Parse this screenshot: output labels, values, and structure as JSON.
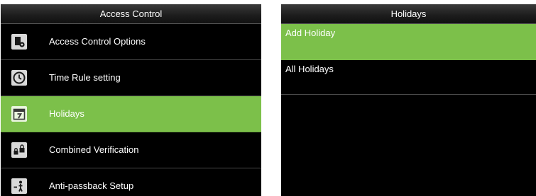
{
  "left_screen": {
    "title": "Access Control",
    "items": [
      {
        "label": "Access Control Options",
        "icon": "access-options-icon",
        "selected": false
      },
      {
        "label": "Time Rule setting",
        "icon": "clock-icon",
        "selected": false
      },
      {
        "label": "Holidays",
        "icon": "calendar-icon",
        "selected": true
      },
      {
        "label": "Combined Verification",
        "icon": "locks-icon",
        "selected": false
      },
      {
        "label": "Anti-passback Setup",
        "icon": "anti-passback-icon",
        "selected": false
      }
    ]
  },
  "right_screen": {
    "title": "Holidays",
    "items": [
      {
        "label": "Add Holiday",
        "selected": true
      },
      {
        "label": "All Holidays",
        "selected": false
      }
    ]
  },
  "colors": {
    "selected": "#7cc04a",
    "background": "#000000",
    "text": "#ffffff"
  }
}
